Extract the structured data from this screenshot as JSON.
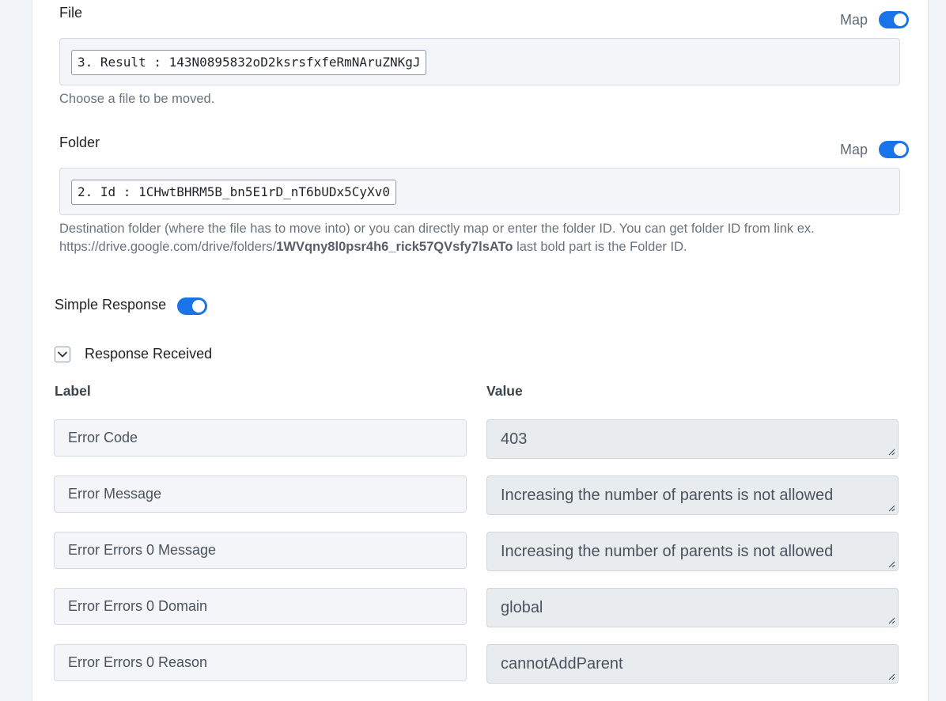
{
  "file": {
    "label": "File",
    "map_label": "Map",
    "chip": "3. Result : 143N0895832oD2ksrsfxfeRmNAruZNKgJ",
    "help": "Choose a file to be moved."
  },
  "folder": {
    "label": "Folder",
    "map_label": "Map",
    "chip": "2. Id : 1CHwtBHRM5B_bn5E1rD_nT6bUDx5CyXv0",
    "help_line1": "Destination folder (where the file has to move into) or you can directly map or enter the folder ID. You can get folder ID from link ex.",
    "help_line2_prefix": "https://drive.google.com/drive/folders/",
    "help_line2_bold": "1WVqny8l0psr4h6_rick57QVsfy7lsATo",
    "help_line2_suffix": " last bold part is the Folder ID."
  },
  "simple_response": {
    "label": "Simple Response"
  },
  "response_received": {
    "label": "Response Received",
    "col_label": "Label",
    "col_value": "Value",
    "rows": [
      {
        "label": "Error Code",
        "value": "403"
      },
      {
        "label": "Error Message",
        "value": "Increasing the number of parents is not allowed"
      },
      {
        "label": "Error Errors 0 Message",
        "value": "Increasing the number of parents is not allowed"
      },
      {
        "label": "Error Errors 0 Domain",
        "value": "global"
      },
      {
        "label": "Error Errors 0 Reason",
        "value": "cannotAddParent"
      }
    ]
  },
  "colors": {
    "accent": "#1a73e8",
    "page_bg": "#f1f4f8",
    "field_bg": "#f3f5f8",
    "value_bg": "#e9ecef"
  },
  "icons": {
    "toggle": "toggle-switch-on",
    "chevron": "chevron-down-icon",
    "resize": "resize-grip-icon"
  }
}
